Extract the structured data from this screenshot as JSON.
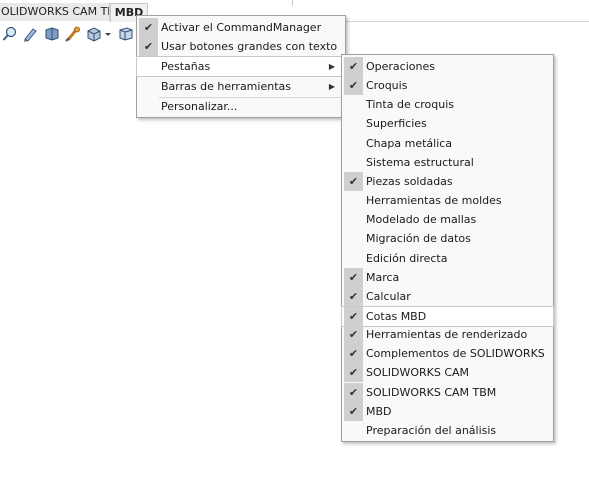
{
  "tabs": {
    "cam_tbm": "OLIDWORKS CAM TBM",
    "mbd": "MBD"
  },
  "toolbar_icons": [
    "zoom-icon",
    "sketch-icon",
    "view-icon",
    "appearance-icon",
    "display-style-icon",
    "dropdown-arrow-icon",
    "cube-view-icon"
  ],
  "menu": {
    "items": [
      {
        "label": "Activar el CommandManager",
        "checked": true
      },
      {
        "label": "Usar botones grandes con texto",
        "checked": true
      },
      {
        "label": "Pestañas",
        "submenu": true
      },
      {
        "label": "Barras de herramientas",
        "submenu": true
      },
      {
        "label": "Personalizar..."
      }
    ],
    "arrow": "▶"
  },
  "submenu": {
    "check_glyph": "✔",
    "items": [
      {
        "label": "Operaciones",
        "checked": true
      },
      {
        "label": "Croquis",
        "checked": true
      },
      {
        "label": "Tinta de croquis",
        "checked": false
      },
      {
        "label": "Superficies",
        "checked": false
      },
      {
        "label": "Chapa metálica",
        "checked": false
      },
      {
        "label": "Sistema estructural",
        "checked": false
      },
      {
        "label": "Piezas soldadas",
        "checked": true
      },
      {
        "label": "Herramientas de moldes",
        "checked": false
      },
      {
        "label": "Modelado de mallas",
        "checked": false
      },
      {
        "label": "Migración de datos",
        "checked": false
      },
      {
        "label": "Edición directa",
        "checked": false
      },
      {
        "label": "Marca",
        "checked": true
      },
      {
        "label": "Calcular",
        "checked": true
      },
      {
        "label": "Cotas MBD",
        "checked": true,
        "hover": true
      },
      {
        "label": "Herramientas de renderizado",
        "checked": true
      },
      {
        "label": "Complementos de SOLIDWORKS",
        "checked": true
      },
      {
        "label": "SOLIDWORKS CAM",
        "checked": true
      },
      {
        "label": "SOLIDWORKS CAM TBM",
        "checked": true
      },
      {
        "label": "MBD",
        "checked": true
      },
      {
        "label": "Preparación del análisis",
        "checked": false
      }
    ]
  }
}
